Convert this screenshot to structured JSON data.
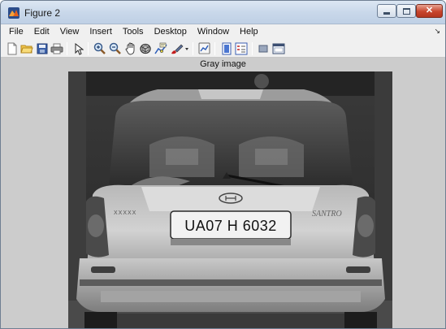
{
  "window": {
    "title": "Figure 2"
  },
  "menubar": {
    "items": [
      {
        "label": "File"
      },
      {
        "label": "Edit"
      },
      {
        "label": "View"
      },
      {
        "label": "Insert"
      },
      {
        "label": "Tools"
      },
      {
        "label": "Desktop"
      },
      {
        "label": "Window"
      },
      {
        "label": "Help"
      }
    ]
  },
  "toolbar": {
    "tools": [
      {
        "icon": "new-figure-icon"
      },
      {
        "icon": "open-file-icon"
      },
      {
        "icon": "save-icon"
      },
      {
        "icon": "print-icon"
      },
      {
        "icon": "edit-plot-icon"
      },
      {
        "icon": "zoom-in-icon"
      },
      {
        "icon": "zoom-out-icon"
      },
      {
        "icon": "pan-icon"
      },
      {
        "icon": "rotate-3d-icon"
      },
      {
        "icon": "data-cursor-icon"
      },
      {
        "icon": "brush-icon"
      },
      {
        "icon": "link-plot-icon"
      },
      {
        "icon": "colorbar-icon"
      },
      {
        "icon": "legend-icon"
      },
      {
        "icon": "hide-plot-tools-icon"
      },
      {
        "icon": "show-plot-tools-icon"
      }
    ]
  },
  "figure": {
    "axes_title": "Gray image",
    "image_description": "grayscale photo of the rear of a hatchback car",
    "plate_text": "UA07 H 6032",
    "badge_text": "SANTRO"
  },
  "colors": {
    "titlebar": "#c9d8ea",
    "close_button": "#c8442c",
    "figure_background": "#cccccc"
  }
}
